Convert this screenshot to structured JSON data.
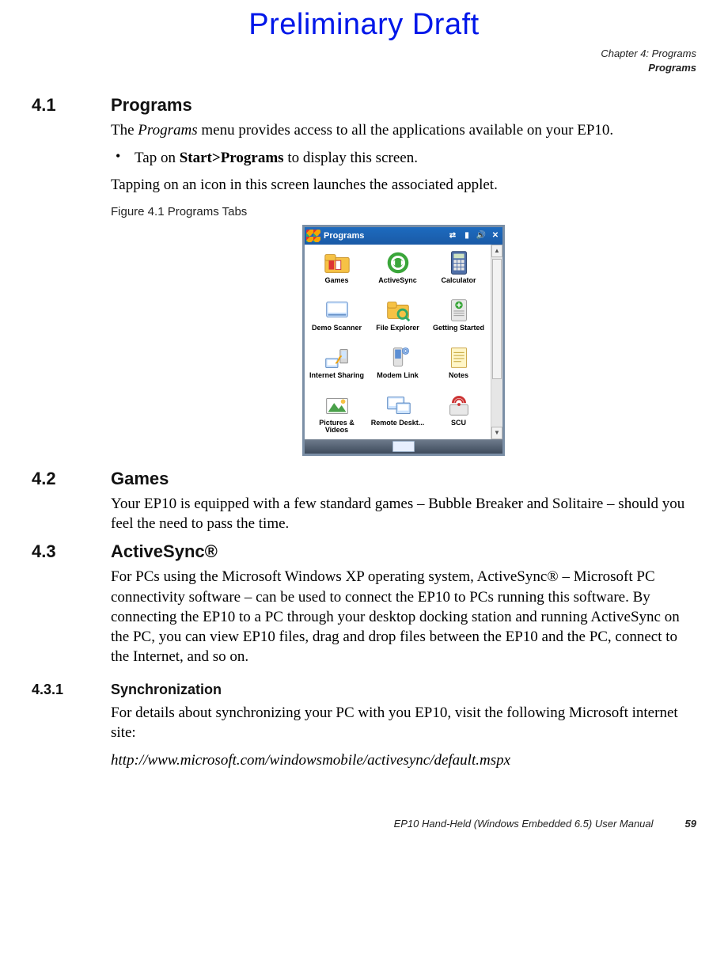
{
  "watermark": "Preliminary Draft",
  "chapter_line": "Chapter 4:  Programs",
  "chapter_sub": "Programs",
  "sections": {
    "s41": {
      "num": "4.1",
      "title": "Programs"
    },
    "s42": {
      "num": "4.2",
      "title": "Games"
    },
    "s43": {
      "num": "4.3",
      "title": "ActiveSync®"
    },
    "s431": {
      "num": "4.3.1",
      "title": "Synchronization"
    }
  },
  "p41_intro_a": "The ",
  "p41_intro_em": "Programs",
  "p41_intro_b": " menu provides access to all the applications available on your EP10.",
  "p41_bullet_a": "Tap on ",
  "p41_bullet_strong": "Start>Programs",
  "p41_bullet_b": " to display this screen.",
  "p41_after": "Tapping on an icon in this screen launches the associated applet.",
  "figure_caption": "Figure 4.1   Programs Tabs",
  "screenshot": {
    "titlebar": "Programs",
    "tiles": [
      {
        "label": "Games"
      },
      {
        "label": "ActiveSync"
      },
      {
        "label": "Calculator"
      },
      {
        "label": "Demo Scanner"
      },
      {
        "label": "File Explorer"
      },
      {
        "label": "Getting Started"
      },
      {
        "label": "Internet Sharing"
      },
      {
        "label": "Modem Link"
      },
      {
        "label": "Notes"
      },
      {
        "label": "Pictures & Videos"
      },
      {
        "label": "Remote Deskt..."
      },
      {
        "label": "SCU"
      }
    ]
  },
  "p42": "Your EP10 is equipped with a few standard games – Bubble Breaker and Solitaire – should you feel the need to pass the time.",
  "p43": "For PCs using the Microsoft Windows XP operating system, ActiveSync® – Microsoft PC connectivity software – can be used to connect the EP10 to PCs running this software. By connecting the EP10 to a PC through your desktop docking station and running ActiveSync on the PC, you can view EP10 files, drag and drop files between the EP10 and the PC, connect to the Internet, and so on.",
  "p431": "For details about synchronizing your PC with you EP10, visit the following Microsoft internet site:",
  "p431_url": "http://www.microsoft.com/windowsmobile/activesync/default.mspx",
  "footer_text": "EP10 Hand-Held (Windows Embedded 6.5) User Manual",
  "footer_page": "59"
}
